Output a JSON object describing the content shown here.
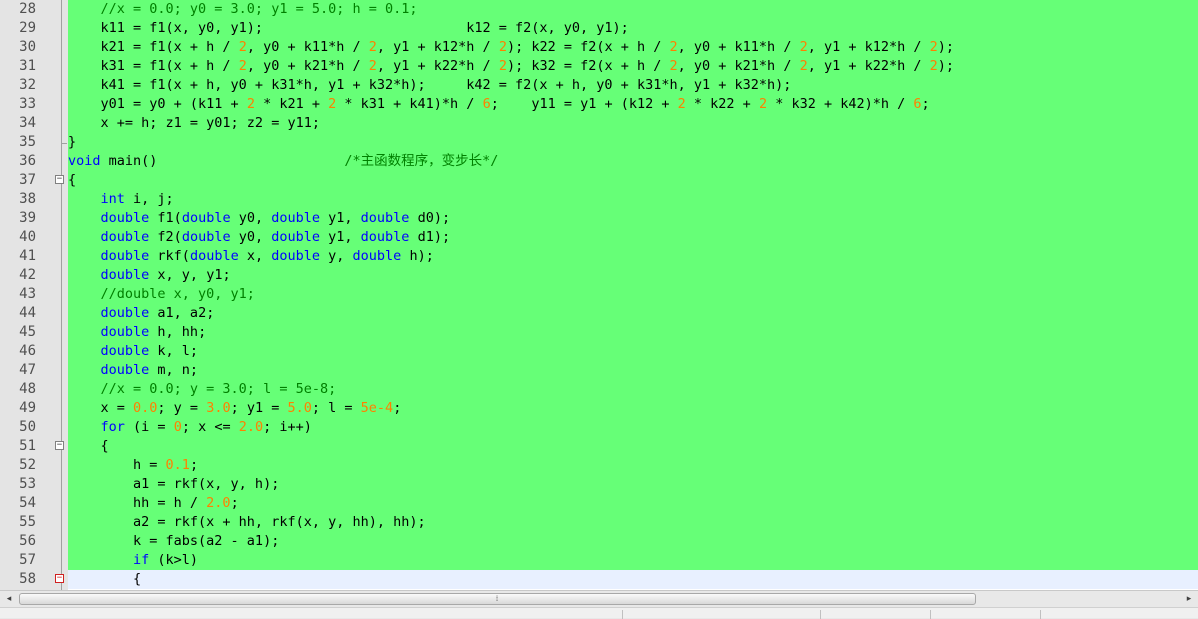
{
  "editor": {
    "first_line_number": 28,
    "current_line_number": 58,
    "colors": {
      "code_background": "#66ff77",
      "current_line_background": "#e8f0ff",
      "keyword": "#0000ff",
      "number": "#ff8000",
      "comment": "#008000",
      "gutter": "#e4e4e4",
      "fold_marker_current": "#d02020"
    },
    "lines": [
      {
        "number": "28",
        "fold": "",
        "tokens": [
          [
            "cm",
            "    //x = 0.0; y0 = 3.0; y1 = 5.0; h = 0.1;"
          ]
        ]
      },
      {
        "number": "29",
        "fold": "",
        "tokens": [
          [
            "pl",
            "    k11 = f1(x, y0, y1);                         k12 = f2(x, y0, y1);"
          ]
        ]
      },
      {
        "number": "30",
        "fold": "",
        "tokens": [
          [
            "pl",
            "    k21 = f1(x + h / "
          ],
          [
            "nm",
            "2"
          ],
          [
            "pl",
            ", y0 + k11*h / "
          ],
          [
            "nm",
            "2"
          ],
          [
            "pl",
            ", y1 + k12*h / "
          ],
          [
            "nm",
            "2"
          ],
          [
            "pl",
            "); k22 = f2(x + h / "
          ],
          [
            "nm",
            "2"
          ],
          [
            "pl",
            ", y0 + k11*h / "
          ],
          [
            "nm",
            "2"
          ],
          [
            "pl",
            ", y1 + k12*h / "
          ],
          [
            "nm",
            "2"
          ],
          [
            "pl",
            ");"
          ]
        ]
      },
      {
        "number": "31",
        "fold": "",
        "tokens": [
          [
            "pl",
            "    k31 = f1(x + h / "
          ],
          [
            "nm",
            "2"
          ],
          [
            "pl",
            ", y0 + k21*h / "
          ],
          [
            "nm",
            "2"
          ],
          [
            "pl",
            ", y1 + k22*h / "
          ],
          [
            "nm",
            "2"
          ],
          [
            "pl",
            "); k32 = f2(x + h / "
          ],
          [
            "nm",
            "2"
          ],
          [
            "pl",
            ", y0 + k21*h / "
          ],
          [
            "nm",
            "2"
          ],
          [
            "pl",
            ", y1 + k22*h / "
          ],
          [
            "nm",
            "2"
          ],
          [
            "pl",
            ");"
          ]
        ]
      },
      {
        "number": "32",
        "fold": "",
        "tokens": [
          [
            "pl",
            "    k41 = f1(x + h, y0 + k31*h, y1 + k32*h);     k42 = f2(x + h, y0 + k31*h, y1 + k32*h);"
          ]
        ]
      },
      {
        "number": "33",
        "fold": "",
        "tokens": [
          [
            "pl",
            "    y01 = y0 + (k11 + "
          ],
          [
            "nm",
            "2"
          ],
          [
            "pl",
            " * k21 + "
          ],
          [
            "nm",
            "2"
          ],
          [
            "pl",
            " * k31 + k41)*h / "
          ],
          [
            "nm",
            "6"
          ],
          [
            "pl",
            ";    y11 = y1 + (k12 + "
          ],
          [
            "nm",
            "2"
          ],
          [
            "pl",
            " * k22 + "
          ],
          [
            "nm",
            "2"
          ],
          [
            "pl",
            " * k32 + k42)*h / "
          ],
          [
            "nm",
            "6"
          ],
          [
            "pl",
            ";"
          ]
        ]
      },
      {
        "number": "34",
        "fold": "",
        "tokens": [
          [
            "pl",
            "    x += h; z1 = y01; z2 = y11;"
          ]
        ]
      },
      {
        "number": "35",
        "fold": "end",
        "tokens": [
          [
            "pl",
            "}"
          ]
        ]
      },
      {
        "number": "36",
        "fold": "",
        "tokens": [
          [
            "kw",
            "void"
          ],
          [
            "pl",
            " main()                       "
          ],
          [
            "cm",
            "/*主函数程序，变步长*/"
          ]
        ]
      },
      {
        "number": "37",
        "fold": "open",
        "tokens": [
          [
            "pl",
            "{"
          ]
        ]
      },
      {
        "number": "38",
        "fold": "",
        "tokens": [
          [
            "pl",
            "    "
          ],
          [
            "kw",
            "int"
          ],
          [
            "pl",
            " i, j;"
          ]
        ]
      },
      {
        "number": "39",
        "fold": "",
        "tokens": [
          [
            "pl",
            "    "
          ],
          [
            "kw",
            "double"
          ],
          [
            "pl",
            " f1("
          ],
          [
            "kw",
            "double"
          ],
          [
            "pl",
            " y0, "
          ],
          [
            "kw",
            "double"
          ],
          [
            "pl",
            " y1, "
          ],
          [
            "kw",
            "double"
          ],
          [
            "pl",
            " d0);"
          ]
        ]
      },
      {
        "number": "40",
        "fold": "",
        "tokens": [
          [
            "pl",
            "    "
          ],
          [
            "kw",
            "double"
          ],
          [
            "pl",
            " f2("
          ],
          [
            "kw",
            "double"
          ],
          [
            "pl",
            " y0, "
          ],
          [
            "kw",
            "double"
          ],
          [
            "pl",
            " y1, "
          ],
          [
            "kw",
            "double"
          ],
          [
            "pl",
            " d1);"
          ]
        ]
      },
      {
        "number": "41",
        "fold": "",
        "tokens": [
          [
            "pl",
            "    "
          ],
          [
            "kw",
            "double"
          ],
          [
            "pl",
            " rkf("
          ],
          [
            "kw",
            "double"
          ],
          [
            "pl",
            " x, "
          ],
          [
            "kw",
            "double"
          ],
          [
            "pl",
            " y, "
          ],
          [
            "kw",
            "double"
          ],
          [
            "pl",
            " h);"
          ]
        ]
      },
      {
        "number": "42",
        "fold": "",
        "tokens": [
          [
            "pl",
            "    "
          ],
          [
            "kw",
            "double"
          ],
          [
            "pl",
            " x, y, y1;"
          ]
        ]
      },
      {
        "number": "43",
        "fold": "",
        "tokens": [
          [
            "cm",
            "    //double x, y0, y1;"
          ]
        ]
      },
      {
        "number": "44",
        "fold": "",
        "tokens": [
          [
            "pl",
            "    "
          ],
          [
            "kw",
            "double"
          ],
          [
            "pl",
            " a1, a2;"
          ]
        ]
      },
      {
        "number": "45",
        "fold": "",
        "tokens": [
          [
            "pl",
            "    "
          ],
          [
            "kw",
            "double"
          ],
          [
            "pl",
            " h, hh;"
          ]
        ]
      },
      {
        "number": "46",
        "fold": "",
        "tokens": [
          [
            "pl",
            "    "
          ],
          [
            "kw",
            "double"
          ],
          [
            "pl",
            " k, l;"
          ]
        ]
      },
      {
        "number": "47",
        "fold": "",
        "tokens": [
          [
            "pl",
            "    "
          ],
          [
            "kw",
            "double"
          ],
          [
            "pl",
            " m, n;"
          ]
        ]
      },
      {
        "number": "48",
        "fold": "",
        "tokens": [
          [
            "cm",
            "    //x = 0.0; y = 3.0; l = 5e-8;"
          ]
        ]
      },
      {
        "number": "49",
        "fold": "",
        "tokens": [
          [
            "pl",
            "    x = "
          ],
          [
            "nm",
            "0.0"
          ],
          [
            "pl",
            "; y = "
          ],
          [
            "nm",
            "3.0"
          ],
          [
            "pl",
            "; y1 = "
          ],
          [
            "nm",
            "5.0"
          ],
          [
            "pl",
            "; l = "
          ],
          [
            "nm",
            "5e-4"
          ],
          [
            "pl",
            ";"
          ]
        ]
      },
      {
        "number": "50",
        "fold": "",
        "tokens": [
          [
            "pl",
            "    "
          ],
          [
            "kw",
            "for"
          ],
          [
            "pl",
            " (i = "
          ],
          [
            "nm",
            "0"
          ],
          [
            "pl",
            "; x <= "
          ],
          [
            "nm",
            "2.0"
          ],
          [
            "pl",
            "; i++)"
          ]
        ]
      },
      {
        "number": "51",
        "fold": "open",
        "tokens": [
          [
            "pl",
            "    {"
          ]
        ]
      },
      {
        "number": "52",
        "fold": "",
        "tokens": [
          [
            "pl",
            "        h = "
          ],
          [
            "nm",
            "0.1"
          ],
          [
            "pl",
            ";"
          ]
        ]
      },
      {
        "number": "53",
        "fold": "",
        "tokens": [
          [
            "pl",
            "        a1 = rkf(x, y, h);"
          ]
        ]
      },
      {
        "number": "54",
        "fold": "",
        "tokens": [
          [
            "pl",
            "        hh = h / "
          ],
          [
            "nm",
            "2.0"
          ],
          [
            "pl",
            ";"
          ]
        ]
      },
      {
        "number": "55",
        "fold": "",
        "tokens": [
          [
            "pl",
            "        a2 = rkf(x + hh, rkf(x, y, hh), hh);"
          ]
        ]
      },
      {
        "number": "56",
        "fold": "",
        "tokens": [
          [
            "pl",
            "        k = fabs(a2 - a1);"
          ]
        ]
      },
      {
        "number": "57",
        "fold": "",
        "tokens": [
          [
            "pl",
            "        "
          ],
          [
            "kw",
            "if"
          ],
          [
            "pl",
            " (k>l)"
          ]
        ]
      },
      {
        "number": "58",
        "fold": "open-current",
        "tokens": [
          [
            "pl",
            "        {"
          ]
        ]
      }
    ]
  },
  "scrollbar": {
    "left_arrow": "◂",
    "right_arrow": "▸",
    "grip": "⁞"
  }
}
